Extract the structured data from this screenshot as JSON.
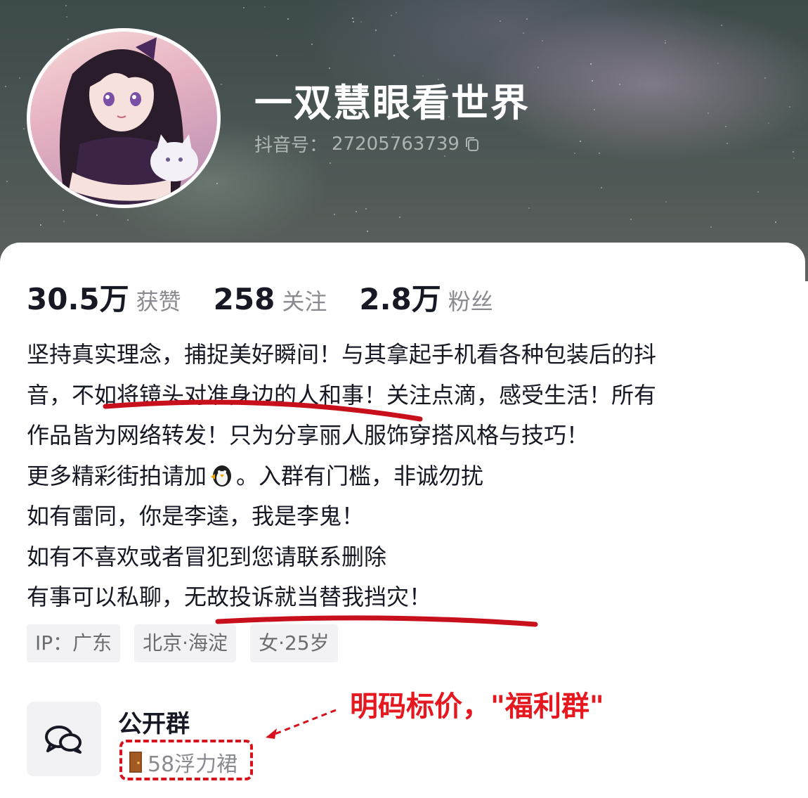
{
  "profile": {
    "name": "一双慧眼看世界",
    "douyin_id_label": "抖音号：",
    "douyin_id": "27205763739"
  },
  "stats": [
    {
      "value": "30.5万",
      "label": "获赞"
    },
    {
      "value": "258",
      "label": "关注"
    },
    {
      "value": "2.8万",
      "label": "粉丝"
    }
  ],
  "bio": {
    "line1": "坚持真实理念，捕捉美好瞬间！与其拿起手机看各种包装后的抖",
    "line2": "音，不如将镜头对准身边的人和事！关注点滴，感受生活！所有",
    "line3": "作品皆为网络转发！只为分享丽人服饰穿搭风格与技巧！",
    "line4_before": "更多精彩街拍请加",
    "line4_after": "。入群有门槛，非诚勿扰",
    "line5": "如有雷同，你是李逵，我是李鬼！",
    "line6": "如有不喜欢或者冒犯到您请联系删除",
    "line7": "有事可以私聊，无故投诉就当替我挡灾！"
  },
  "tags": [
    "IP：广东",
    "北京·海淀",
    "女·25岁"
  ],
  "group": {
    "title": "公开群",
    "subtitle": "58浮力裙",
    "icon": "chat-bubbles-icon"
  },
  "annotation": {
    "text": "明码标价，\"福利群\"",
    "color": "#e5171f"
  },
  "colors": {
    "text_primary": "#161823",
    "text_secondary": "#8a8b91",
    "tag_bg": "#f2f2f4",
    "annotation_red": "#d8121d"
  }
}
